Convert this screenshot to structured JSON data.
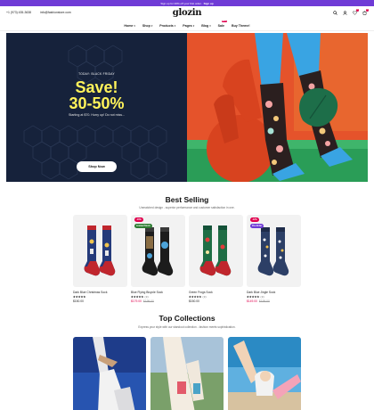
{
  "announcement": {
    "text": "Sign up for 20% off your first order.",
    "link": "Sign up"
  },
  "header": {
    "phone": "+1 (973) 435-3638",
    "email": "info@fashionstore.com",
    "logo": "glozin",
    "nav": [
      "Home",
      "Shop",
      "Products",
      "Pages",
      "Blog",
      "Sale",
      "Buy Theme!"
    ],
    "hot_badge": "HOT",
    "cart_count": "0",
    "wishlist_count": "0"
  },
  "hero": {
    "eyebrow": "TODAY: BLACK FRIDAY",
    "headline_line1": "Save!",
    "headline_line2": "30-50%",
    "subtext": "Starting at $70. Hurry up! Do not miss...",
    "cta": "Shop Now"
  },
  "best_selling": {
    "title": "Best Selling",
    "subtitle": "Unmatched design - superior performance and customer satisfaction in one.",
    "products": [
      {
        "name": "Dark Blue Christmas Sock",
        "rating": "★★★★★",
        "reviews": "",
        "price": "$150.00",
        "old_price": "",
        "badges": []
      },
      {
        "name": "Blue Flying Bicycle Sock",
        "rating": "★★★★★",
        "reviews": "(3)",
        "price": "$179.00",
        "old_price": "$199.00",
        "badges": [
          {
            "text": "-10%",
            "color": "#e0004d"
          },
          {
            "text": "Limited Stock",
            "color": "#2e7d32"
          }
        ]
      },
      {
        "name": "Green Frogs Sock",
        "rating": "★★★★★",
        "reviews": "(3)",
        "price": "$150.00",
        "old_price": "",
        "badges": []
      },
      {
        "name": "Dark Blue Jingle Sock",
        "rating": "★★★★★",
        "reviews": "(3)",
        "price": "$149.00",
        "old_price": "$159.00",
        "badges": [
          {
            "text": "-12%",
            "color": "#e0004d"
          },
          {
            "text": "Pre-Order",
            "color": "#6f3bd6"
          }
        ]
      }
    ]
  },
  "top_collections": {
    "title": "Top Collections",
    "subtitle": "Express your style with our standout collection - fashion meets sophistication."
  }
}
